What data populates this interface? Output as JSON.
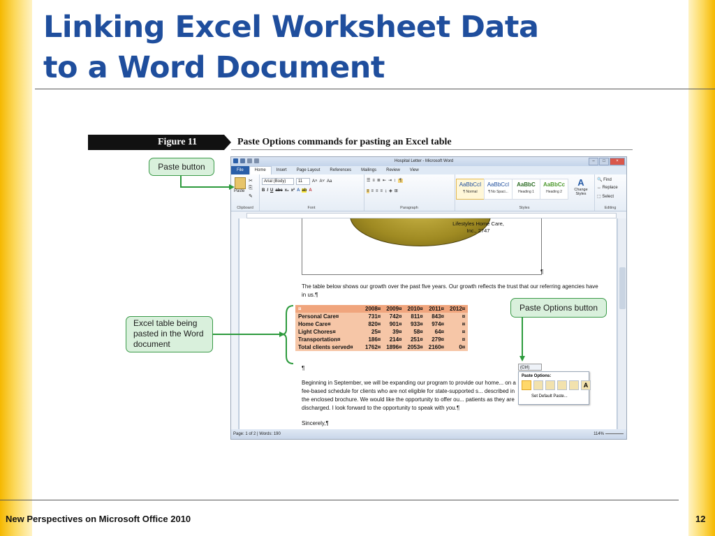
{
  "slide": {
    "title_line1": "Linking Excel Worksheet Data",
    "title_line2": "to a Word Document",
    "footer": "New Perspectives on Microsoft Office 2010",
    "page_number": "12"
  },
  "figure": {
    "number": "Figure 11",
    "caption": "Paste Options commands for pasting an Excel table"
  },
  "callouts": {
    "paste_button": "Paste button",
    "excel_table": "Excel table being pasted in the Word document",
    "paste_options": "Paste Options button"
  },
  "word": {
    "window_title": "Hospital Letter - Microsoft Word",
    "tabs": [
      "File",
      "Home",
      "Insert",
      "Page Layout",
      "References",
      "Mailings",
      "Review",
      "View"
    ],
    "paste_label": "Paste",
    "font_name": "Arial (Body)",
    "font_size": "11",
    "groups": {
      "clipboard": "Clipboard",
      "font": "Font",
      "paragraph": "Paragraph",
      "styles": "Styles",
      "editing": "Editing"
    },
    "styles": [
      {
        "sample": "AaBbCcI",
        "name": "¶ Normal"
      },
      {
        "sample": "AaBbCcI",
        "name": "¶ No Spaci..."
      },
      {
        "sample": "AaBbC",
        "name": "Heading 1"
      },
      {
        "sample": "AaBbCc",
        "name": "Heading 2"
      }
    ],
    "change_styles": "Change Styles",
    "editing": {
      "find": "Find",
      "replace": "Replace",
      "select": "Select"
    },
    "status": {
      "page": "Page: 1 of 2",
      "words": "Words: 190",
      "zoom": "114%"
    }
  },
  "document": {
    "chart_label": "Lifestyles Home Care, Inc., 2747",
    "para1": "The table below shows our growth over the past five years. Our growth reflects the trust that our referring agencies have in us.¶",
    "pilcrow": "¶",
    "table": {
      "headers": [
        "¤",
        "2008¤",
        "2009¤",
        "2010¤",
        "2011¤",
        "2012¤"
      ],
      "rows": [
        [
          "Personal Care¤",
          "731¤",
          "742¤",
          "811¤",
          "843¤",
          "¤"
        ],
        [
          "Home Care¤",
          "820¤",
          "901¤",
          "933¤",
          "974¤",
          "¤"
        ],
        [
          "Light Chores¤",
          "25¤",
          "39¤",
          "58¤",
          "64¤",
          "¤"
        ],
        [
          "Transportation¤",
          "186¤",
          "214¤",
          "251¤",
          "279¤",
          "¤"
        ],
        [
          "Total clients served¤",
          "1762¤",
          "1896¤",
          "2053¤",
          "2160¤",
          "0¤"
        ]
      ]
    },
    "para2": "Beginning in September, we will be expanding our program to provide our home... on a fee-based schedule for clients who are not eligible for state-supported s... described in the enclosed brochure. We would like the opportunity to offer ou... patients as they are discharged. I look forward to the opportunity to speak with you.¶",
    "closing": "Sincerely,¶"
  },
  "paste_options": {
    "tag": "(Ctrl)",
    "header": "Paste Options:",
    "default": "Set Default Paste..."
  },
  "colors": {
    "title": "#1f4e9d",
    "callout_bg": "#d9f0dc",
    "callout_border": "#3a9a48",
    "table_header": "#f0a57d",
    "table_body": "#f6c6a7",
    "accent_bar": "#f5b800"
  }
}
